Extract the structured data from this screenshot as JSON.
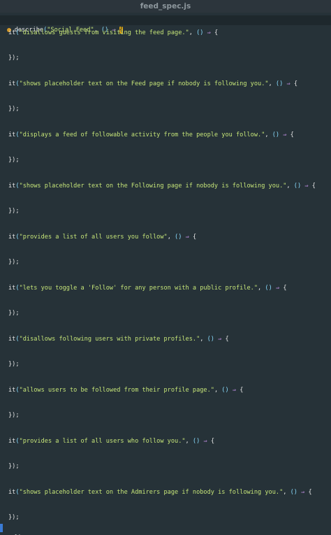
{
  "window": {
    "title": "feed_spec.js"
  },
  "code": {
    "describe_fn": "describe",
    "describe_name": "\"Social Feed\"",
    "describe_sep": ", ",
    "paren_open": "(",
    "paren_close": ")",
    "parens": "()",
    "arrow": "⇒",
    "brace_open": "{",
    "it_fn": "it",
    "comma_sep": ", ",
    "block_close": "});",
    "tests": [
      {
        "name": "\"disallows guests from visiting the feed page.\""
      },
      {
        "name": "\"shows placeholder text on the Feed page if nobody is following you.\""
      },
      {
        "name": "\"displays a feed of followable activity from the people you follow.\""
      },
      {
        "name": "\"shows placeholder text on the Following page if nobody is following you.\""
      },
      {
        "name": "\"provides a list of all users you follow\""
      },
      {
        "name": "\"lets you toggle a 'Follow' for any person with a public profile.\""
      },
      {
        "name": "\"disallows following users with private profiles.\""
      },
      {
        "name": "\"allows users to be followed from their profile page.\""
      },
      {
        "name": "\"provides a list of all users who follow you.\""
      },
      {
        "name": "\"shows placeholder text on the Admirers page if nobody is following you.\""
      }
    ]
  },
  "colors": {
    "background": "#263238",
    "string": "#c5e478",
    "paren": "#89ddff",
    "arrow": "#c792ea",
    "bracket_match": "#d4a017"
  }
}
